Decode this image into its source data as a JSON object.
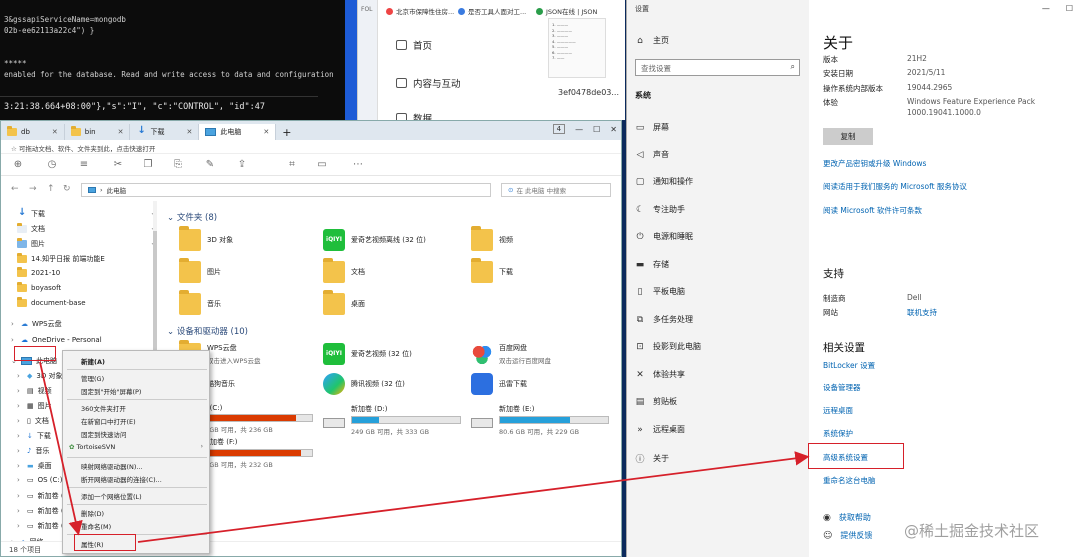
{
  "terminal": {
    "lines": [
      "3&gssapiServiceName=mongodb",
      "02b-ee62113a22c4\") }",
      "",
      "",
      "*****",
      "enabled for the database. Read and write access to data and configuration"
    ],
    "overlay_line": "3:21:38.664+08:00\"},\"s\":\"I\",  \"c\":\"CONTROL\",  \"id\":47"
  },
  "background_app": {
    "side_label": "FOL",
    "tabs": [
      "北京市保障性住房...",
      "是否工具人面对工...",
      "JSON在线 | JSON"
    ],
    "nav": [
      "首页",
      "内容与互动",
      "数据"
    ],
    "hash": "3ef0478de03..."
  },
  "explorer": {
    "tabs": [
      "db",
      "bin",
      "下载",
      "此电脑"
    ],
    "new_tab": "+",
    "tab_count": "4",
    "banner": "可拖动文档、软件、文件夹到此，点击快速打开",
    "address": "此电脑",
    "search_placeholder": "在 此电脑 中搜索",
    "sidebar": [
      {
        "label": "下载",
        "icon": "download-icon"
      },
      {
        "label": "文档",
        "icon": "document-icon"
      },
      {
        "label": "图片",
        "icon": "picture-icon"
      },
      {
        "label": "14.知乎日报 前端功能E",
        "icon": "folder-icon"
      },
      {
        "label": "2021-10",
        "icon": "folder-icon"
      },
      {
        "label": "boyasoft",
        "icon": "folder-icon"
      },
      {
        "label": "document-base",
        "icon": "folder-icon"
      },
      {
        "label": "WPS云盘",
        "icon": "cloud-icon"
      },
      {
        "label": "OneDrive - Personal",
        "icon": "onedrive-icon"
      },
      {
        "label": "此电脑",
        "icon": "computer-icon"
      },
      {
        "label": "3D 对象",
        "icon": "cube-icon"
      },
      {
        "label": "视频",
        "icon": "video-icon"
      },
      {
        "label": "图片",
        "icon": "picture-icon"
      },
      {
        "label": "文档",
        "icon": "document-icon"
      },
      {
        "label": "下载",
        "icon": "download-icon"
      },
      {
        "label": "音乐",
        "icon": "music-icon"
      },
      {
        "label": "桌面",
        "icon": "desktop-icon"
      },
      {
        "label": "OS (C:)",
        "icon": "drive-icon"
      },
      {
        "label": "新加卷 (D:",
        "icon": "drive-icon"
      },
      {
        "label": "新加卷 (E:",
        "icon": "drive-icon"
      },
      {
        "label": "新加卷 (F:",
        "icon": "drive-icon"
      },
      {
        "label": "网络",
        "icon": "network-icon"
      }
    ],
    "folders_section": "文件夹 (8)",
    "folders": [
      {
        "name": "3D 对象",
        "kind": "fold"
      },
      {
        "name": "爱奇艺视频离线 (32 位)",
        "kind": "iqiyi"
      },
      {
        "name": "视频",
        "kind": "fold"
      },
      {
        "name": "图片",
        "kind": "fold"
      },
      {
        "name": "文档",
        "kind": "fold"
      },
      {
        "name": "下载",
        "kind": "fold"
      },
      {
        "name": "音乐",
        "kind": "fold"
      },
      {
        "name": "桌面",
        "kind": "fold"
      }
    ],
    "devices_section": "设备和驱动器 (10)",
    "devices": [
      {
        "name": "WPS云盘",
        "sub": "双击进入WPS云盘",
        "kind": "fold"
      },
      {
        "name": "爱奇艺视频 (32 位)",
        "kind": "iqiyi"
      },
      {
        "name": "百度网盘",
        "sub": "双击运行百度网盘",
        "kind": "baidu"
      },
      {
        "name": "酷狗音乐",
        "kind": "fold"
      },
      {
        "name": "腾讯视频 (32 位)",
        "kind": "tencent"
      },
      {
        "name": "迅雷下载",
        "kind": "thunder"
      }
    ],
    "drives": [
      {
        "name": "S (C:)",
        "free": "6 GB 可用，共 236 GB",
        "used": 0.85
      },
      {
        "name": "新加卷 (D:)",
        "free": "249 GB 可用，共 333 GB",
        "used": 0.25
      },
      {
        "name": "新加卷 (E:)",
        "free": "80.6 GB 可用，共 229 GB",
        "used": 0.65
      },
      {
        "name": "新加卷 (F:)",
        "free": "8 GB 可用，共 232 GB",
        "used": 0.9
      }
    ],
    "status": "18 个项目"
  },
  "context_menu": {
    "items": [
      "新建(A)",
      "管理(G)",
      "固定到\"开始\"屏幕(P)",
      "360文件夹打开",
      "在新窗口中打开(E)",
      "固定到快速访问",
      "TortoiseSVN",
      "映射网络驱动器(N)...",
      "断开网络驱动器的连接(C)...",
      "添加一个网络位置(L)",
      "删除(D)",
      "重命名(M)",
      "属性(R)"
    ]
  },
  "settings": {
    "app_title": "设置",
    "home": "主页",
    "search_placeholder": "查找设置",
    "section": "系统",
    "nav": [
      "屏幕",
      "声音",
      "通知和操作",
      "专注助手",
      "电源和睡眠",
      "存储",
      "平板电脑",
      "多任务处理",
      "投影到此电脑",
      "体验共享",
      "剪贴板",
      "远程桌面",
      "关于"
    ],
    "heading": "关于",
    "specs": [
      {
        "k": "版本",
        "v": "21H2"
      },
      {
        "k": "安装日期",
        "v": "2021/5/11"
      },
      {
        "k": "操作系统内部版本",
        "v": "19044.2965"
      },
      {
        "k": "体验",
        "v": "Windows Feature Experience Pack"
      },
      {
        "k": "",
        "v": "1000.19041.1000.0"
      }
    ],
    "copy": "复制",
    "links": [
      "更改产品密钥或升级 Windows",
      "阅读适用于我们服务的 Microsoft 服务协议",
      "阅读 Microsoft 软件许可条款"
    ],
    "support_heading": "支持",
    "support": [
      {
        "k": "制造商",
        "v": "Dell"
      },
      {
        "k": "网站",
        "v": "联机支持"
      }
    ],
    "related_heading": "相关设置",
    "related": [
      "BitLocker 设置",
      "设备管理器",
      "远程桌面",
      "系统保护",
      "高级系统设置",
      "重命名这台电脑"
    ],
    "help": [
      "获取帮助",
      "提供反馈"
    ]
  },
  "watermark": "@稀土掘金技术社区",
  "colors": {
    "accent": "#0063b1",
    "annotation": "#d6202a"
  }
}
